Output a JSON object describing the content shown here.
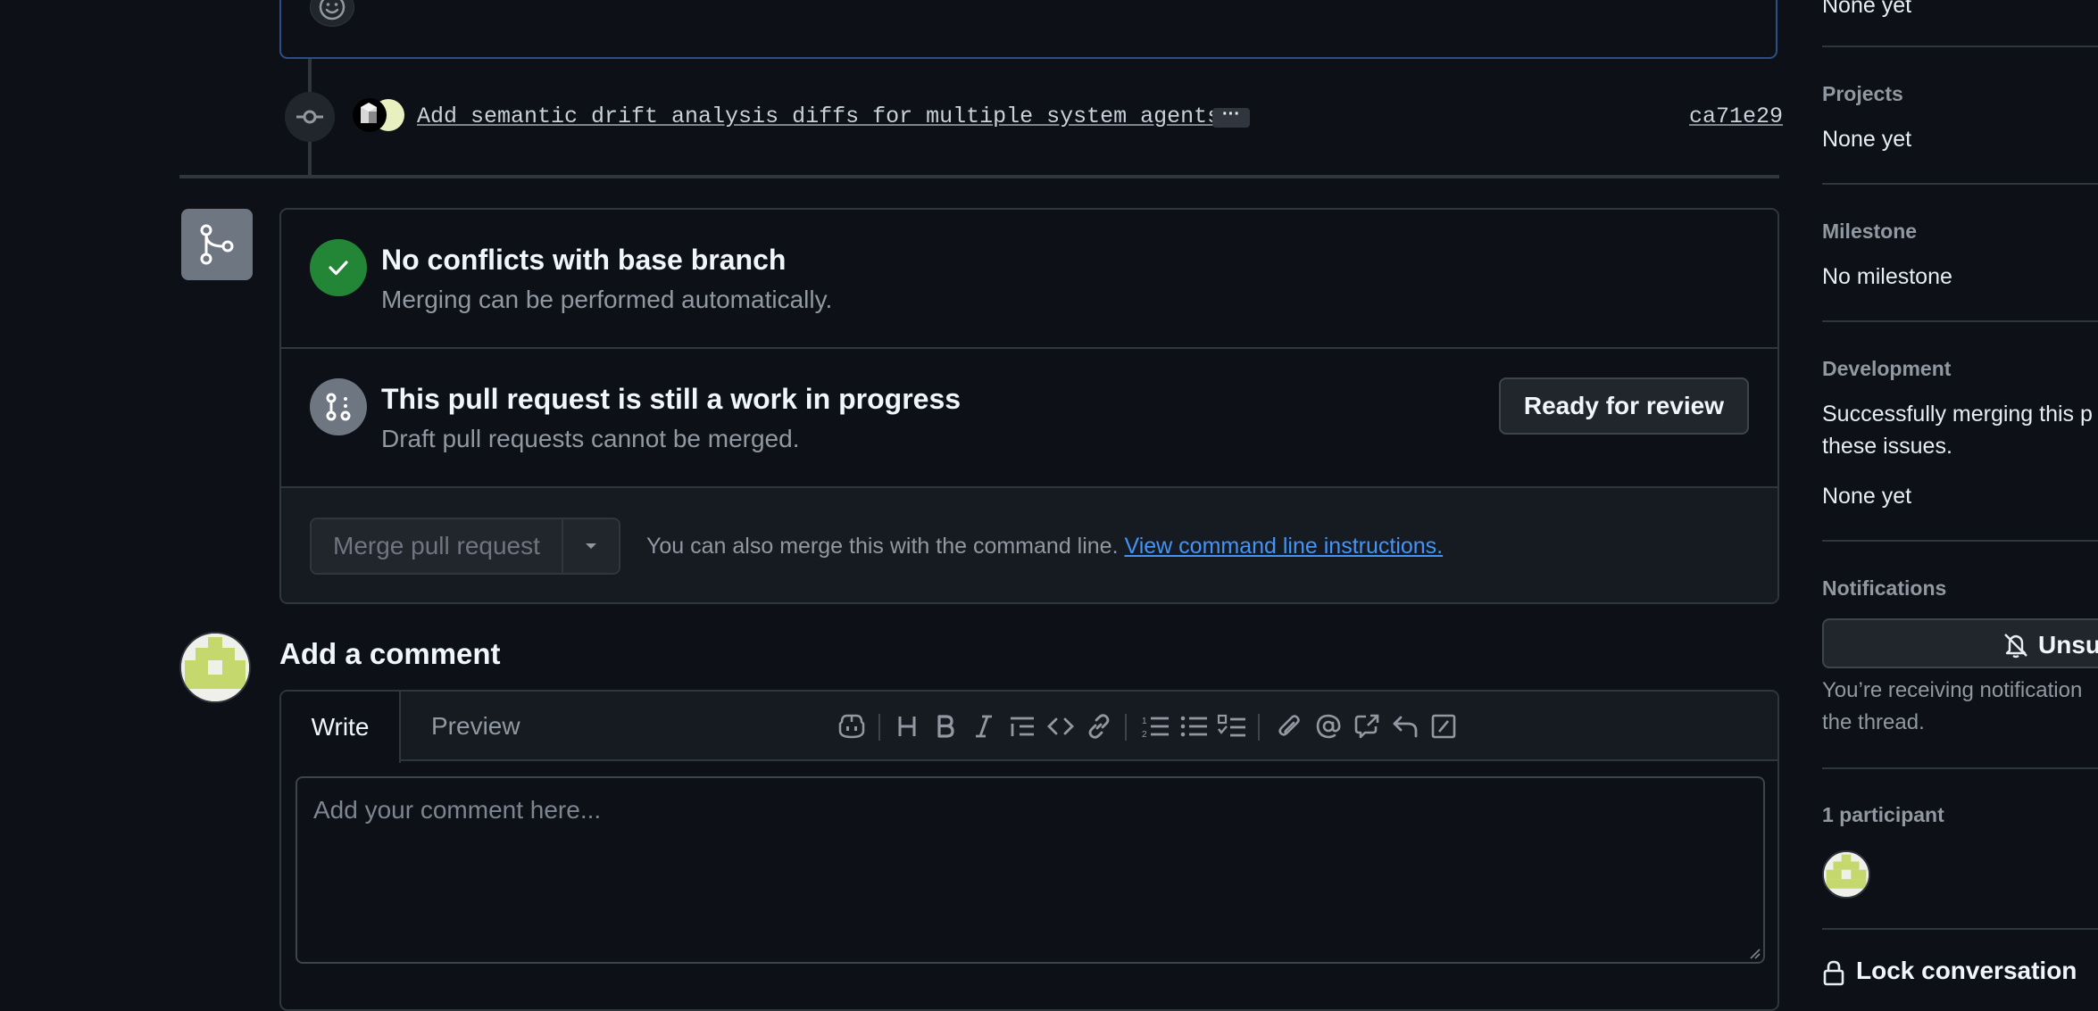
{
  "timeline": {
    "commit_message": "Add semantic drift analysis diffs for multiple system agents",
    "commit_ellipsis": "···",
    "commit_sha": "ca71e29"
  },
  "merge_box": {
    "conflicts_title": "No conflicts with base branch",
    "conflicts_subtitle": "Merging can be performed automatically.",
    "draft_title": "This pull request is still a work in progress",
    "draft_subtitle": "Draft pull requests cannot be merged.",
    "ready_button": "Ready for review",
    "merge_button": "Merge pull request",
    "merge_note": "You can also merge this with the command line.",
    "merge_note_link": "View command line instructions."
  },
  "comment": {
    "heading": "Add a comment",
    "tab_write": "Write",
    "tab_preview": "Preview",
    "placeholder": "Add your comment here..."
  },
  "sidebar": {
    "top_value": "None yet",
    "projects_label": "Projects",
    "projects_value": "None yet",
    "milestone_label": "Milestone",
    "milestone_value": "No milestone",
    "development_label": "Development",
    "development_line1": "Successfully merging this p",
    "development_line2": "these issues.",
    "development_value": "None yet",
    "notifications_label": "Notifications",
    "unsubscribe_button": "Unsub",
    "notifications_line1": "You’re receiving notification",
    "notifications_line2": "the thread.",
    "participants_label": "1 participant",
    "lock_label": "Lock conversation"
  },
  "colors": {
    "background": "#0d1117",
    "success": "#238636",
    "link": "#4493f8",
    "avatar_green": "#c5d86d"
  }
}
